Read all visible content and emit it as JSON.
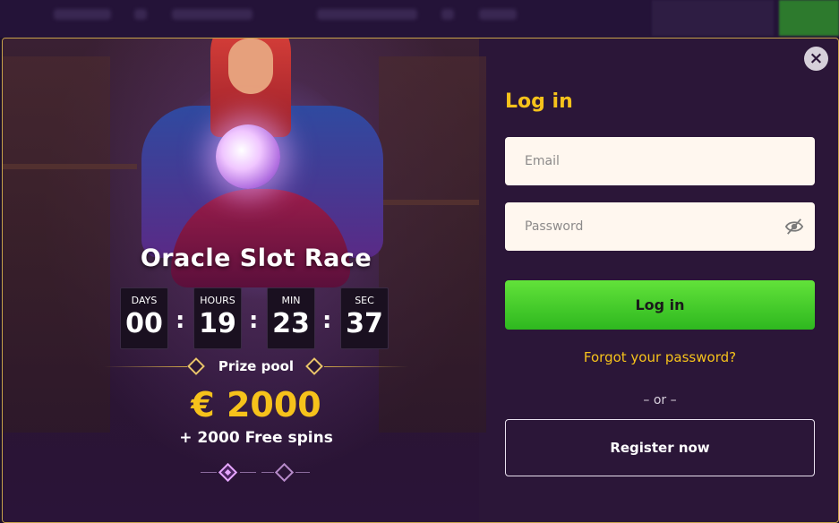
{
  "promo": {
    "title": "Oracle Slot Race",
    "countdown": [
      {
        "label": "DAYS",
        "value": "00"
      },
      {
        "label": "HOURS",
        "value": "19"
      },
      {
        "label": "MIN",
        "value": "23"
      },
      {
        "label": "SEC",
        "value": "37"
      }
    ],
    "separator": ":",
    "prize_label": "Prize pool",
    "prize_amount": "€ 2000",
    "prize_extra": "+ 2000 Free spins",
    "slides": 2,
    "active_slide": 1
  },
  "login": {
    "title": "Log in",
    "email_placeholder": "Email",
    "password_placeholder": "Password",
    "login_button": "Log in",
    "forgot_password": "Forgot your password?",
    "or_divider": "– or –",
    "register_button": "Register now",
    "close_symbol": "×"
  },
  "icons": {
    "close": "close-icon",
    "password_visibility": "eye-off-icon"
  },
  "colors": {
    "accent": "#f6c21b",
    "login_button": "#3fcb2a",
    "modal_border": "#c7a24a",
    "background": "#2b1638"
  }
}
